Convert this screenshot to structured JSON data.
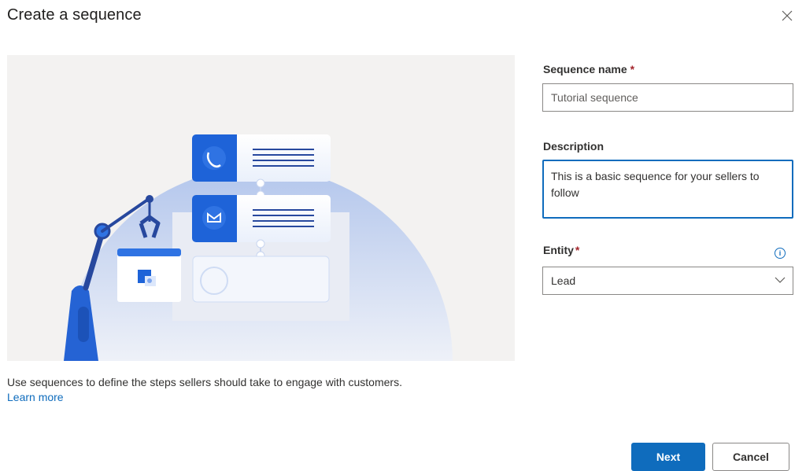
{
  "dialog": {
    "title": "Create a sequence"
  },
  "intro": {
    "text": "Use sequences to define the steps sellers should take to engage with customers.",
    "learn_more": "Learn more"
  },
  "form": {
    "name": {
      "label": "Sequence name",
      "required_mark": "*",
      "value": "Tutorial sequence"
    },
    "description": {
      "label": "Description",
      "value": "This is a basic sequence for your sellers to follow"
    },
    "entity": {
      "label": "Entity",
      "required_mark": "*",
      "selected": "Lead"
    }
  },
  "buttons": {
    "next": "Next",
    "cancel": "Cancel"
  },
  "icons": {
    "close": "close-icon",
    "info": "info-icon",
    "dropdown": "chevron-down-icon"
  },
  "colors": {
    "accent": "#0f6cbd",
    "required": "#a4262c"
  }
}
